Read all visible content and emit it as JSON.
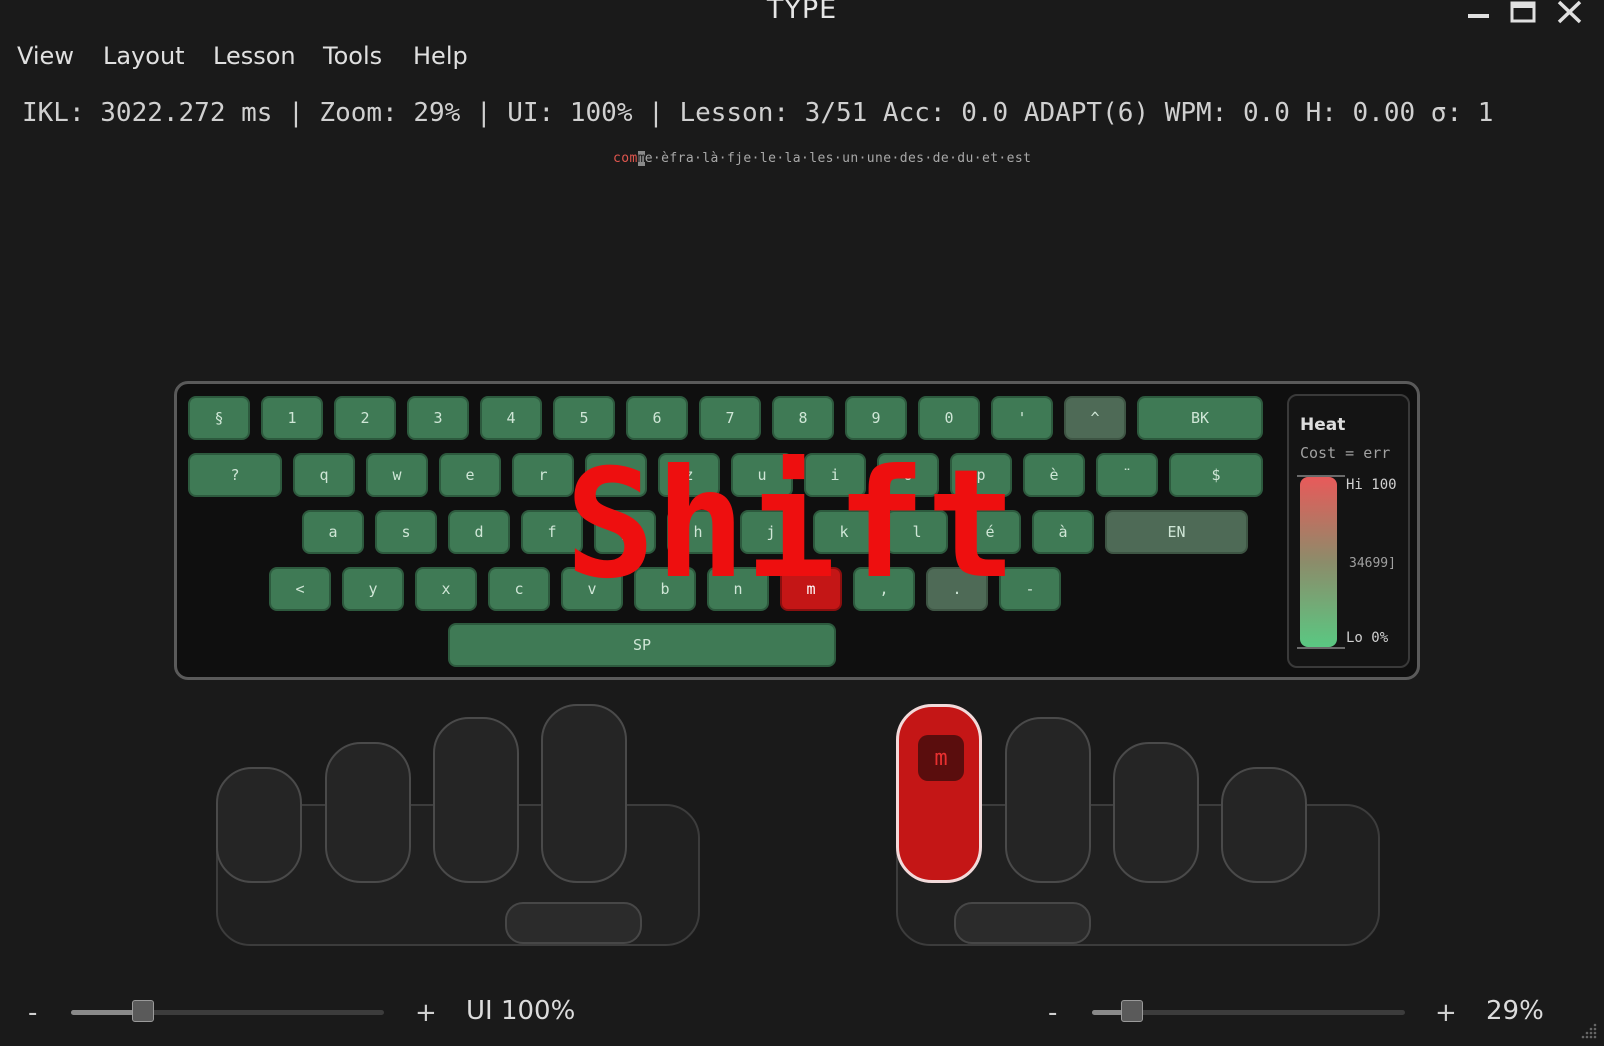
{
  "window": {
    "title": "TYPE"
  },
  "menu": [
    {
      "label": "View"
    },
    {
      "label": "Layout"
    },
    {
      "label": "Lesson"
    },
    {
      "label": "Tools"
    },
    {
      "label": "Help"
    }
  ],
  "status_text": "IKL: 3022.272 ms | Zoom: 29% | UI: 100% | Lesson: 3/51 Acc: 0.0 ADAPT(6) WPM: 0.0 H: 0.00 σ: 1",
  "lesson": {
    "typed": "com",
    "cursor_char": "m",
    "remaining": "e·èfra·là·fje·le·la·les·un·une·des·de·du·et·est"
  },
  "keyboard": {
    "rows": [
      [
        "§",
        "1",
        "2",
        "3",
        "4",
        "5",
        "6",
        "7",
        "8",
        "9",
        "0",
        "'",
        "^",
        "BK"
      ],
      [
        "?",
        "q",
        "w",
        "e",
        "r",
        "t",
        "z",
        "u",
        "i",
        "o",
        "p",
        "è",
        "¨",
        "$"
      ],
      [
        "a",
        "s",
        "d",
        "f",
        "g",
        "h",
        "j",
        "k",
        "l",
        "é",
        "à",
        "EN"
      ],
      [
        "<",
        "y",
        "x",
        "c",
        "v",
        "b",
        "n",
        "m",
        ",",
        ".",
        "-"
      ],
      [
        "SP"
      ]
    ],
    "active_key": "m",
    "overlay": "Shift"
  },
  "heat": {
    "title": "Heat",
    "subtitle": "Cost = err",
    "hi": "Hi 100",
    "mid": "34699]",
    "lo": "Lo 0%"
  },
  "hands": {
    "active_finger_key": "m"
  },
  "ui_zoom": {
    "minus": "-",
    "plus": "+",
    "label": "UI 100%",
    "value": 0.2
  },
  "kb_zoom": {
    "minus": "-",
    "plus": "+",
    "label": "29%",
    "value": 0.1
  },
  "colors": {
    "key": "#3f7a55",
    "key_dim": "#4e6a56",
    "active": "#c41616",
    "overlay": "#ee0f0f",
    "bg": "#1a1a1a"
  }
}
